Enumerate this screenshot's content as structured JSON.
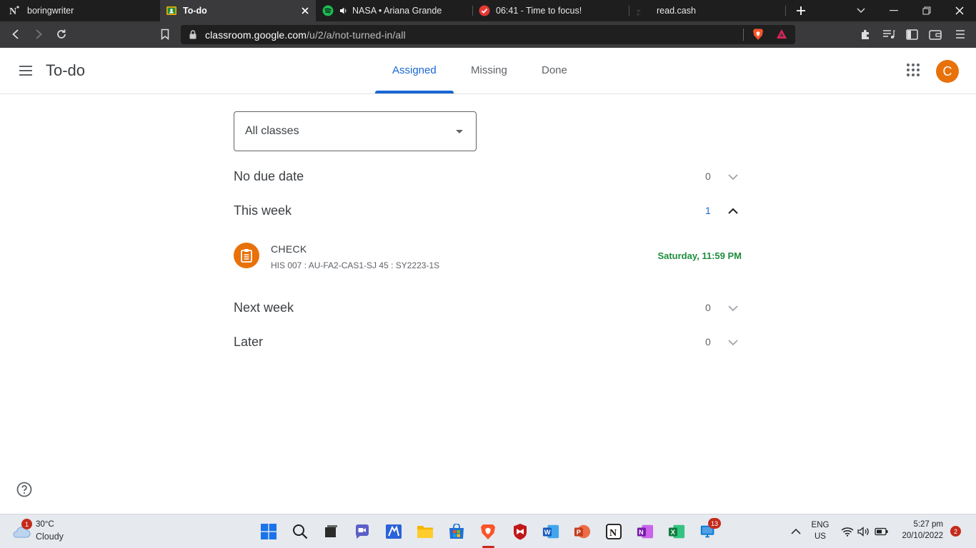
{
  "browser": {
    "tabs": [
      {
        "title": "boringwriter",
        "icon": "notion-n-icon"
      },
      {
        "title": "To-do",
        "icon": "classroom-icon",
        "active": true
      },
      {
        "title": "NASA • Ariana Grande",
        "icon": "spotify-icon",
        "audio": true
      },
      {
        "title": "06:41 - Time to focus!",
        "icon": "focus-check-icon"
      },
      {
        "title": "read.cash",
        "icon": "readcash-icon"
      }
    ],
    "url": {
      "host": "classroom.google.com",
      "path": "/u/2/a/not-turned-in/all"
    }
  },
  "app": {
    "title": "To-do",
    "tabs": [
      "Assigned",
      "Missing",
      "Done"
    ],
    "active_tab": "Assigned",
    "avatar_letter": "C",
    "accent": "#1967d2",
    "avatar_color": "#e8710a"
  },
  "filter": {
    "selected": "All classes"
  },
  "sections": [
    {
      "title": "No due date",
      "count": "0",
      "expanded": false
    },
    {
      "title": "This week",
      "count": "1",
      "expanded": true
    },
    {
      "title": "Next week",
      "count": "0",
      "expanded": false
    },
    {
      "title": "Later",
      "count": "0",
      "expanded": false
    }
  ],
  "assignments": [
    {
      "title": "CHECK",
      "class": "HIS 007 : AU-FA2-CAS1-SJ 45 : SY2223-1S",
      "due": "Saturday, 11:59 PM",
      "due_color": "#1e8e3e"
    }
  ],
  "taskbar": {
    "weather": {
      "temp": "30°C",
      "condition": "Cloudy",
      "badge": "1"
    },
    "teams_badge": "13",
    "lang": {
      "primary": "ENG",
      "secondary": "US"
    },
    "time": "5:27 pm",
    "date": "20/10/2022",
    "notifications": "2"
  }
}
